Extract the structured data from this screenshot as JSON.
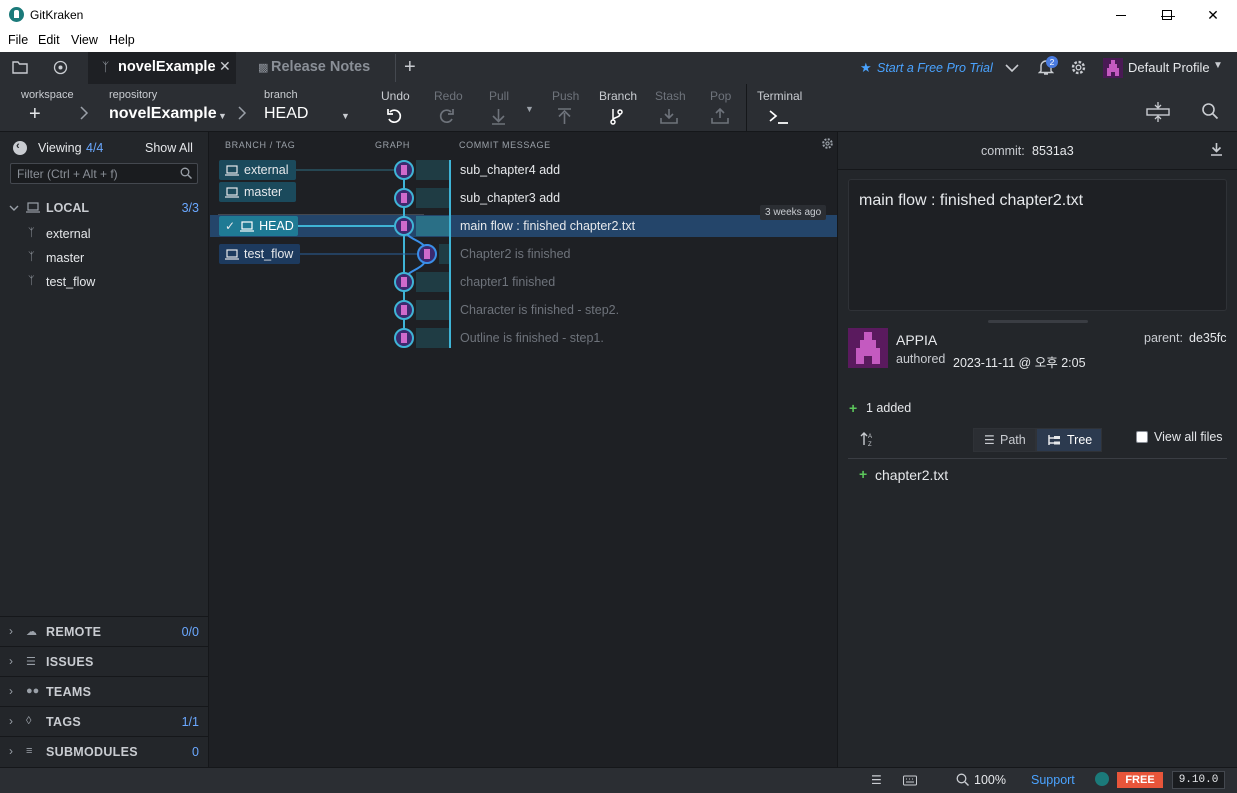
{
  "window": {
    "title": "GitKraken"
  },
  "menu": [
    "File",
    "Edit",
    "View",
    "Help"
  ],
  "tabs": {
    "active": "novelExample",
    "second": "Release Notes"
  },
  "header_right": {
    "pro_trial": "Start a Free Pro Trial",
    "notification_count": "2",
    "profile": "Default Profile"
  },
  "toolbar": {
    "workspace_label": "workspace",
    "repository_label": "repository",
    "repository_value": "novelExample",
    "branch_label": "branch",
    "branch_value": "HEAD",
    "undo": "Undo",
    "redo": "Redo",
    "pull": "Pull",
    "push": "Push",
    "branch": "Branch",
    "stash": "Stash",
    "pop": "Pop",
    "terminal": "Terminal"
  },
  "left": {
    "viewing_label": "Viewing",
    "viewing_count": "4/4",
    "show_all": "Show All",
    "filter_placeholder": "Filter (Ctrl + Alt + f)",
    "local_label": "LOCAL",
    "local_count": "3/3",
    "branches": [
      "external",
      "master",
      "test_flow"
    ],
    "sections": [
      {
        "label": "REMOTE",
        "count": "0/0",
        "icon": "cloud-icon"
      },
      {
        "label": "ISSUES",
        "count": "",
        "icon": "list-icon"
      },
      {
        "label": "TEAMS",
        "count": "",
        "icon": "team-icon"
      },
      {
        "label": "TAGS",
        "count": "1/1",
        "icon": "tag-icon"
      },
      {
        "label": "SUBMODULES",
        "count": "0",
        "icon": "layers-icon"
      }
    ]
  },
  "graph": {
    "col_branch": "BRANCH / TAG",
    "col_graph": "GRAPH",
    "col_message": "COMMIT MESSAGE",
    "tags": {
      "external": "external",
      "master": "master",
      "head": "HEAD",
      "test_flow": "test_flow"
    },
    "commits": [
      {
        "message": "sub_chapter4 add",
        "dim": false
      },
      {
        "message": "sub_chapter3 add",
        "dim": false
      },
      {
        "message": "main flow : finished chapter2.txt",
        "dim": false,
        "selected": true
      },
      {
        "message": "Chapter2 is finished",
        "dim": true
      },
      {
        "message": "chapter1 finished",
        "dim": true
      },
      {
        "message": "Character is finished - step2.",
        "dim": true
      },
      {
        "message": "Outline is finished - step1.",
        "dim": true
      }
    ],
    "time_badge": "3 weeks ago"
  },
  "detail": {
    "commit_label": "commit:",
    "commit_hash": "8531a3",
    "message": "main flow : finished chapter2.txt",
    "author": "APPIA",
    "authored_label": "authored",
    "authored_date": "2023-11-11 @ 오후 2:05",
    "parent_label": "parent:",
    "parent_hash": "de35fc",
    "added_summary": "1 added",
    "path_btn": "Path",
    "tree_btn": "Tree",
    "view_all": "View all files",
    "files": [
      "chapter2.txt"
    ]
  },
  "status": {
    "zoom": "100%",
    "support": "Support",
    "plan": "FREE",
    "version": "9.10.0"
  },
  "colors": {
    "accent": "#1b7a7a",
    "branch_tag": "#1b4a5c",
    "selected_row": "#24456a",
    "free_badge": "#e8553a",
    "link_blue": "#4aa3ff",
    "added_green": "#5cc85c"
  }
}
